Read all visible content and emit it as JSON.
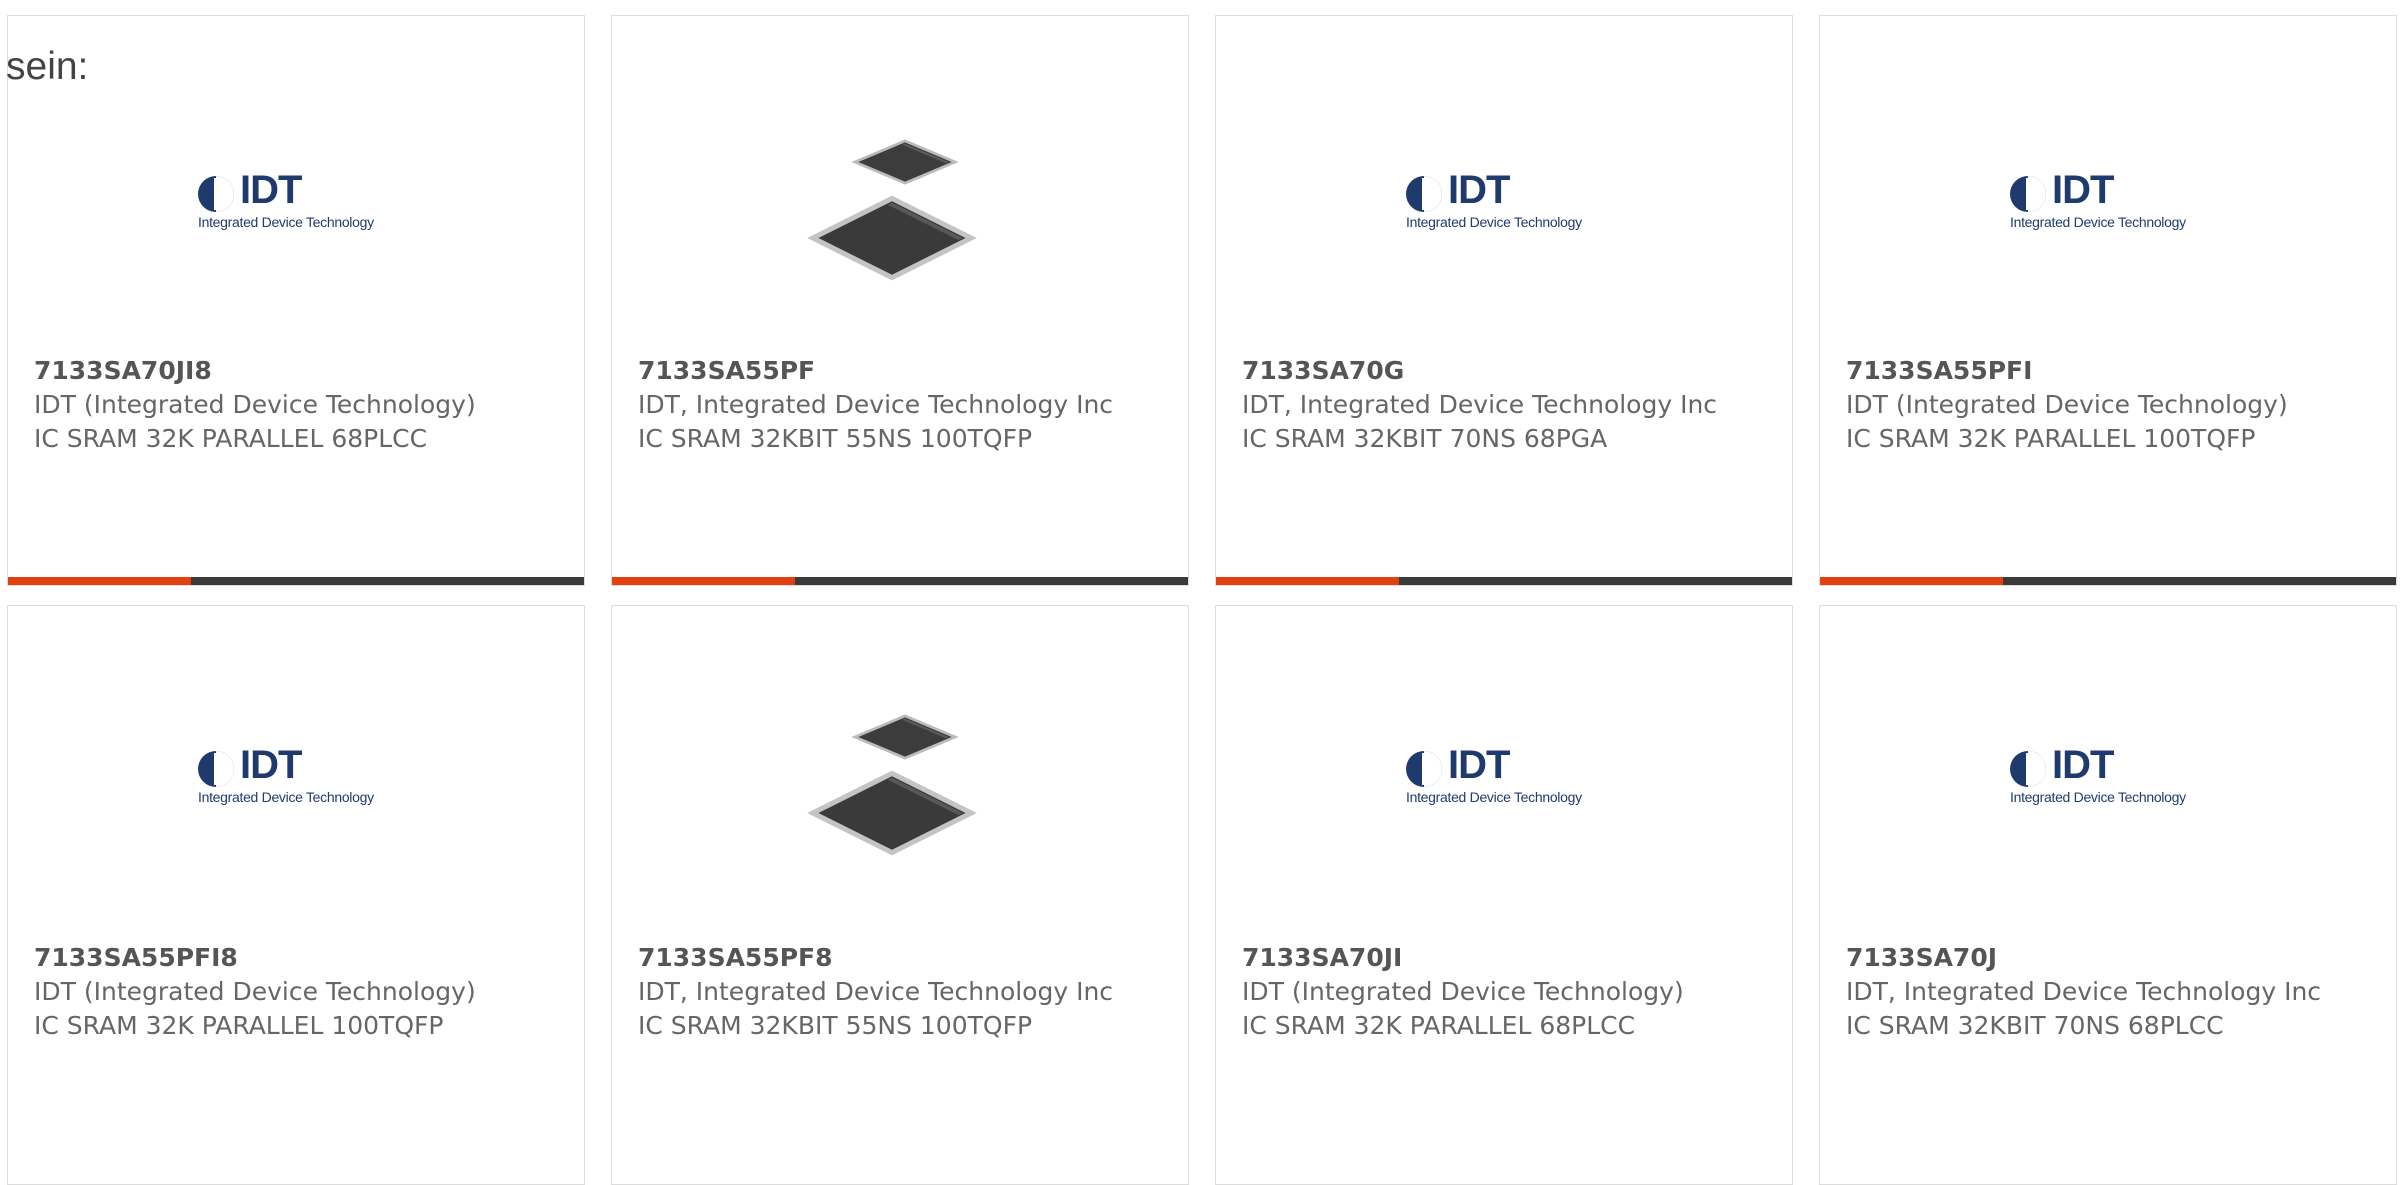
{
  "lead": "sein:",
  "logo": {
    "letters": "IDT",
    "tagline": "Integrated Device Technology"
  },
  "products": [
    {
      "part": "7133SA70JI8",
      "manufacturer": "IDT (Integrated Device Technology)",
      "description": "IC SRAM 32K PARALLEL 68PLCC",
      "image": "idt-logo"
    },
    {
      "part": "7133SA55PF",
      "manufacturer": "IDT, Integrated Device Technology Inc",
      "description": "IC SRAM 32KBIT 55NS 100TQFP",
      "image": "chip-photo"
    },
    {
      "part": "7133SA70G",
      "manufacturer": "IDT, Integrated Device Technology Inc",
      "description": "IC SRAM 32KBIT 70NS 68PGA",
      "image": "idt-logo"
    },
    {
      "part": "7133SA55PFI",
      "manufacturer": "IDT (Integrated Device Technology)",
      "description": "IC SRAM 32K PARALLEL 100TQFP",
      "image": "idt-logo"
    },
    {
      "part": "7133SA55PFI8",
      "manufacturer": "IDT (Integrated Device Technology)",
      "description": "IC SRAM 32K PARALLEL 100TQFP",
      "image": "idt-logo"
    },
    {
      "part": "7133SA55PF8",
      "manufacturer": "IDT, Integrated Device Technology Inc",
      "description": "IC SRAM 32KBIT 55NS 100TQFP",
      "image": "chip-photo"
    },
    {
      "part": "7133SA70JI",
      "manufacturer": "IDT (Integrated Device Technology)",
      "description": "IC SRAM 32K PARALLEL 68PLCC",
      "image": "idt-logo"
    },
    {
      "part": "7133SA70J",
      "manufacturer": "IDT, Integrated Device Technology Inc",
      "description": "IC SRAM 32KBIT 70NS 68PLCC",
      "image": "idt-logo"
    }
  ],
  "colors": {
    "accent": "#e3400f",
    "bar": "#3a3a3a",
    "logo": "#1f3b6e"
  }
}
